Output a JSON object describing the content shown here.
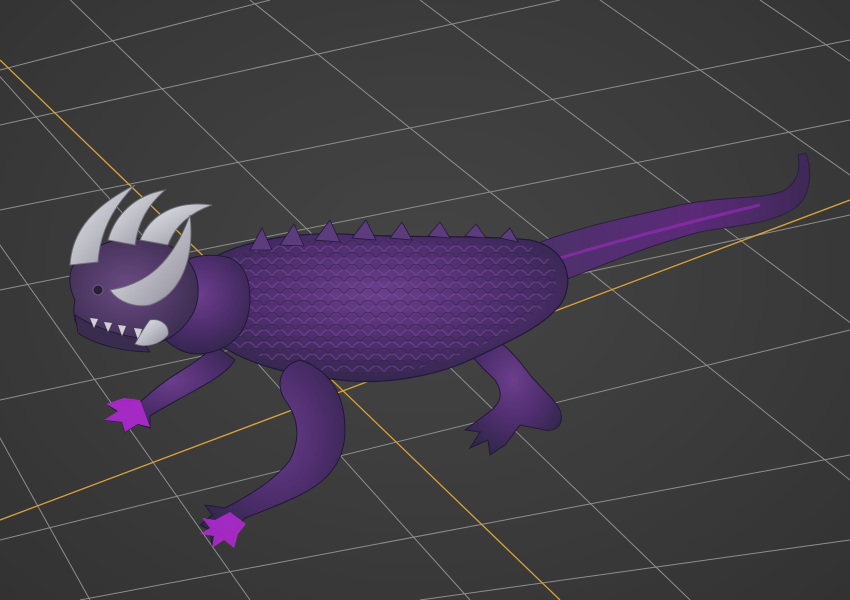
{
  "viewport": {
    "background_color": "#3b3b3b",
    "grid_line_color": "#8e8e8e",
    "axis_line_color": "#d9a23a"
  },
  "model": {
    "body_color": "#5a2f7a",
    "body_dark_color": "#3c2a5e",
    "accent_color": "#b62ad6",
    "horn_color": "#c9c9cf"
  }
}
